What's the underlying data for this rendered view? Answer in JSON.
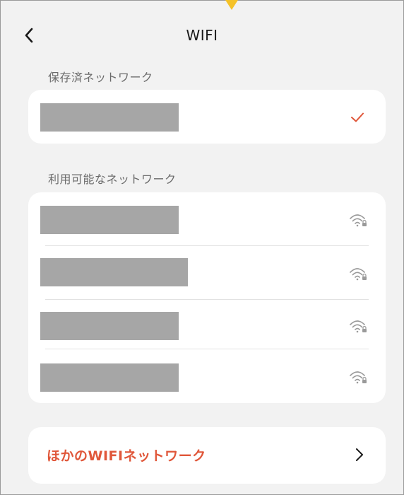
{
  "header": {
    "title": "WIFI",
    "back_icon": "chevron-left-icon"
  },
  "saved": {
    "label": "保存済ネットワーク",
    "networks": [
      {
        "name": "",
        "connected": true,
        "status_icon": "checkmark-icon"
      }
    ]
  },
  "available": {
    "label": "利用可能なネットワーク",
    "networks": [
      {
        "name": "",
        "status_icon": "wifi-lock-icon"
      },
      {
        "name": "",
        "status_icon": "wifi-lock-icon"
      },
      {
        "name": "",
        "status_icon": "wifi-lock-icon"
      },
      {
        "name": "",
        "status_icon": "wifi-lock-icon"
      }
    ]
  },
  "other": {
    "label": "ほかのWIFIネットワーク",
    "icon": "chevron-right-icon"
  },
  "colors": {
    "accent": "#e0573a",
    "background": "#f2f2f2",
    "card": "#ffffff",
    "redaction": "#a6a6a6",
    "marker": "#f5c228"
  }
}
